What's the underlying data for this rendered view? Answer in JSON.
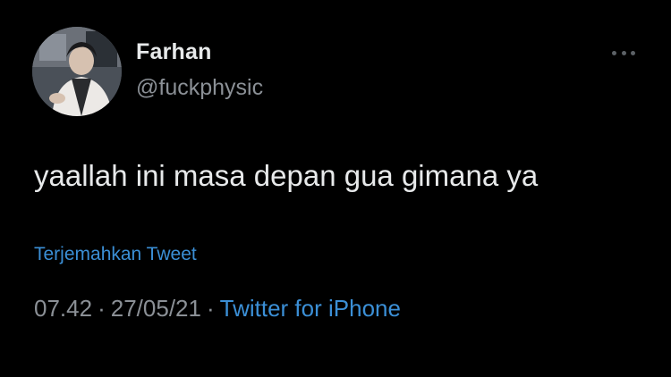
{
  "user": {
    "display_name": "Farhan",
    "handle": "@fuckphysic",
    "avatar_icon": "profile-photo"
  },
  "tweet": {
    "text": "yaallah ini masa depan gua gimana ya",
    "translate_label": "Terjemahkan Tweet"
  },
  "meta": {
    "time": "07.42",
    "date": "27/05/21",
    "separator": "·",
    "source": "Twitter for iPhone"
  },
  "colors": {
    "background": "#000000",
    "text": "#e7e9ea",
    "secondary_text": "#8b9096",
    "link": "#3b8fd6"
  },
  "more_icon": "more-horizontal-icon"
}
